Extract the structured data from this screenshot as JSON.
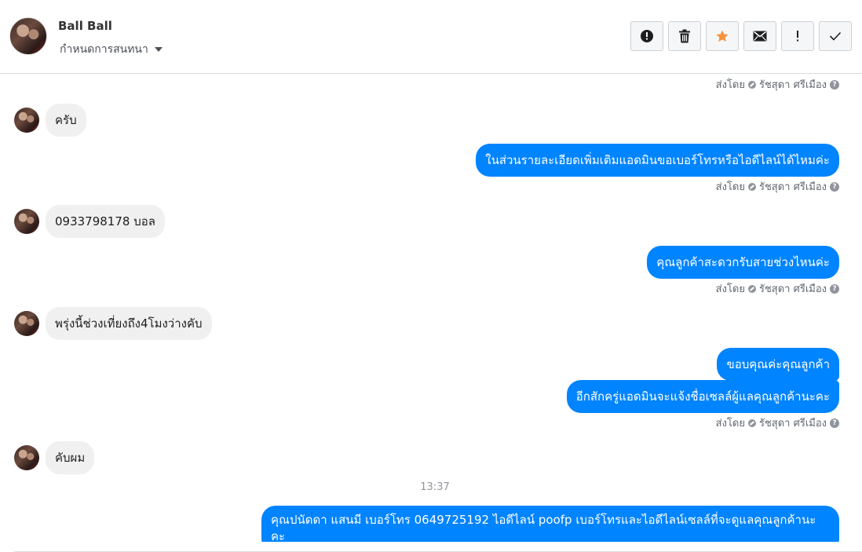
{
  "header": {
    "contact_name": "Ball Ball",
    "conversation_settings": "กำหนดการสนทนา"
  },
  "toolbar": {
    "buttons": [
      {
        "name": "report",
        "icon": "alert-circle-icon",
        "label": "!"
      },
      {
        "name": "delete",
        "icon": "trash-icon"
      },
      {
        "name": "star",
        "icon": "star-icon",
        "color": "#f7923b"
      },
      {
        "name": "mark-unread",
        "icon": "envelope-icon"
      },
      {
        "name": "important",
        "icon": "exclamation-icon",
        "label": "!"
      },
      {
        "name": "done",
        "icon": "check-icon"
      }
    ]
  },
  "sent_by": {
    "prefix": "ส่งโดย",
    "agent": "รัชสุดา ศรีเมือง"
  },
  "messages": [
    {
      "dir": "in",
      "text": "ครับ"
    },
    {
      "dir": "out",
      "text": "ในส่วนรายละเอียดเพิ่มเติมแอดมินขอเบอร์โทรหรือไอดีไลน์ได้ไหมค่ะ"
    },
    {
      "dir": "in",
      "text": "0933798178 บอล"
    },
    {
      "dir": "out",
      "text": "คุณลูกค้าสะดวกรับสายช่วงไหนค่ะ"
    },
    {
      "dir": "in",
      "text": "พรุ่งนี้ช่วงเที่ยงถึง4โมงว่างคับ"
    },
    {
      "dir": "out",
      "text": "ขอบคุณค่ะคุณลูกค้า"
    },
    {
      "dir": "out",
      "text": "อีกสักครู่แอดมินจะแจ้งชื่อเซลล์ผู้แลคุณลูกค้านะคะ"
    },
    {
      "dir": "in",
      "text": "คับผม"
    },
    {
      "dir": "time",
      "text": "13:37"
    },
    {
      "dir": "out",
      "text": "คุณปนัดดา แสนมี   เบอร์โทร 0649725192  ไอดีไลน์ poofp  เบอร์โทรและไอดีไลน์เซลล์ที่จะดูแลคุณลูกค้านะคะ"
    }
  ],
  "colors": {
    "outgoing_bubble": "#0084ff",
    "incoming_bubble": "#f1f0f0",
    "star": "#f7923b"
  }
}
